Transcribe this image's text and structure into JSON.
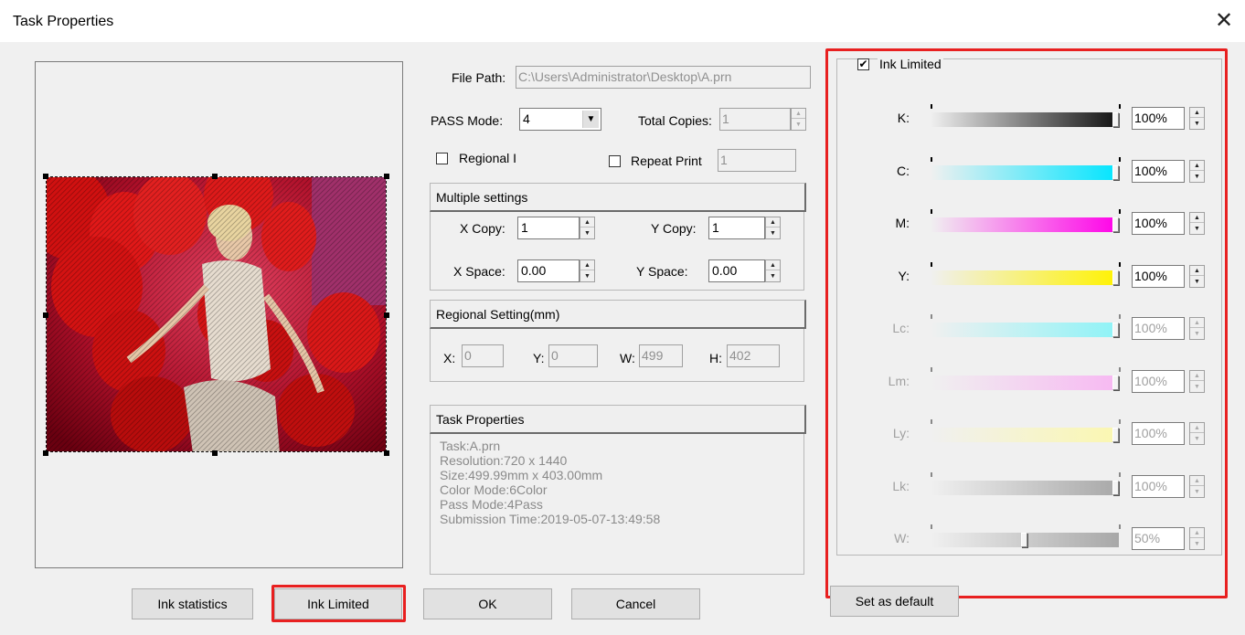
{
  "window": {
    "title": "Task Properties",
    "close_glyph": "✕"
  },
  "file_path": {
    "label": "File Path:",
    "value": "C:\\Users\\Administrator\\Desktop\\A.prn"
  },
  "pass_mode": {
    "label": "PASS Mode:",
    "value": "4"
  },
  "total_copies": {
    "label": "Total Copies:",
    "value": "1"
  },
  "regional": {
    "label": "Regional I",
    "checked": false
  },
  "repeat_print": {
    "label": "Repeat Print",
    "value": "1",
    "checked": false
  },
  "multiple": {
    "header": "Multiple settings",
    "x_copy_label": "X Copy:",
    "x_copy": "1",
    "y_copy_label": "Y Copy:",
    "y_copy": "1",
    "x_space_label": "X Space:",
    "x_space": "0.00",
    "y_space_label": "Y Space:",
    "y_space": "0.00"
  },
  "regional_setting": {
    "header": "Regional Setting(mm)",
    "x_label": "X:",
    "x": "0",
    "y_label": "Y:",
    "y": "0",
    "w_label": "W:",
    "w": "499",
    "h_label": "H:",
    "h": "402"
  },
  "task_props": {
    "header": "Task Properties",
    "lines": [
      "Task:A.prn",
      "Resolution:720 x 1440",
      "Size:499.99mm x 403.00mm",
      "Color Mode:6Color",
      "Pass Mode:4Pass",
      "Submission Time:2019-05-07-13:49:58"
    ]
  },
  "ink_limited": {
    "label": "Ink Limited",
    "checked": true,
    "channels": [
      {
        "label": "K:",
        "value": "100%",
        "level": 1.0,
        "enabled": true,
        "color": "#111111"
      },
      {
        "label": "C:",
        "value": "100%",
        "level": 1.0,
        "enabled": true,
        "color": "#00e5ff"
      },
      {
        "label": "M:",
        "value": "100%",
        "level": 1.0,
        "enabled": true,
        "color": "#ff00e8"
      },
      {
        "label": "Y:",
        "value": "100%",
        "level": 1.0,
        "enabled": true,
        "color": "#fff200"
      },
      {
        "label": "Lc:",
        "value": "100%",
        "level": 1.0,
        "enabled": false,
        "color": "#8df3f7"
      },
      {
        "label": "Lm:",
        "value": "100%",
        "level": 1.0,
        "enabled": false,
        "color": "#f7b8f2"
      },
      {
        "label": "Ly:",
        "value": "100%",
        "level": 1.0,
        "enabled": false,
        "color": "#fbf7b0"
      },
      {
        "label": "Lk:",
        "value": "100%",
        "level": 1.0,
        "enabled": false,
        "color": "#a8a8a8"
      },
      {
        "label": "W:",
        "value": "50%",
        "level": 0.5,
        "enabled": false,
        "color": "#a8a8a8"
      }
    ]
  },
  "buttons": {
    "ink_statistics": "Ink statistics",
    "ink_limited": "Ink Limited",
    "ok": "OK",
    "cancel": "Cancel",
    "set_default": "Set as default"
  },
  "colors": {
    "highlight": "#e82020",
    "background": "#f0f0f0"
  }
}
